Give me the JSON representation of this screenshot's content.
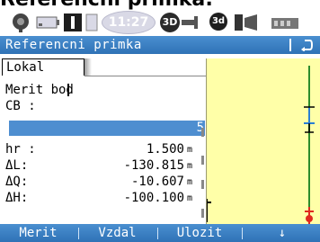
{
  "header": {
    "big_title": "Referenční přímka:"
  },
  "statusbar": {
    "clock": "11:27",
    "quality_badge": "3D",
    "sat_badge": "3d"
  },
  "window": {
    "title": "Referencni primka"
  },
  "tab": {
    "label": "Lokal"
  },
  "form": {
    "merit_bod_label": "Merit bod",
    "cb_label": "CB :",
    "cb_value": "5",
    "rows": [
      {
        "label": "hr :",
        "value": "1.500",
        "unit": "m"
      },
      {
        "label": "ΔL:",
        "value": "-130.815",
        "unit": "m"
      },
      {
        "label": "ΔQ:",
        "value": "-10.607",
        "unit": "m"
      },
      {
        "label": "ΔH:",
        "value": "-100.100",
        "unit": "m"
      }
    ]
  },
  "softkeys": {
    "f1": "Merit",
    "f2": "Vzdal",
    "f3": "Ulozit",
    "f4": "↓"
  },
  "colors": {
    "accent_blue": "#3a7fc4",
    "map_yellow": "#ffffa8",
    "target_red": "#e0281e",
    "line_green": "#2c8c2c"
  }
}
